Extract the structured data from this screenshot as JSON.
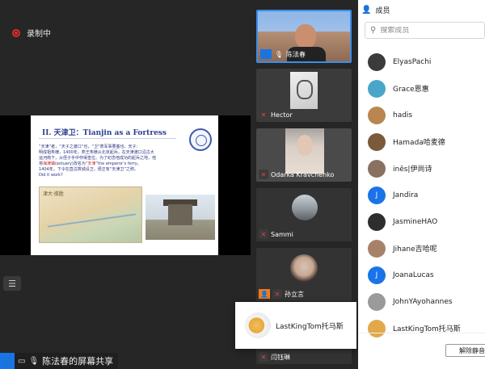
{
  "recording": {
    "label": "录制中"
  },
  "slide": {
    "title": "II. 天津卫：Tianjin as a Fortress",
    "body_line1": "“天津”者，“天子之渡口”也，“卫”表军事要塞也。天子：",
    "body_line2": "明成祖朱棣，1400年，燕王朱棣从北京起兵，在天津渡口沿古大",
    "body_line3": "运河南下，从侄子手中夺得皇位。为了纪念他成功的起兵之地，他",
    "body_line4a": "将",
    "body_line4_red1": "海津镇",
    "body_line4b": "(estuary)改名为“",
    "body_line4_red2": "天津",
    "body_line4c": "”the emperor’s ferry。",
    "body_line5": "1404年，下令在直沽筑城设卫，便正有“天津卫”之称。",
    "body_line6": "Did it work?",
    "map_caption": "津大·揽胜"
  },
  "share_bar": {
    "label": "陈法春的屏幕共享"
  },
  "tiles": [
    {
      "name": "陈法春"
    },
    {
      "name": "Hector"
    },
    {
      "name": "Odarka Kravchenko"
    },
    {
      "name": "Sammi"
    },
    {
      "name": "孙立言"
    },
    {
      "name": "闫钰琳"
    }
  ],
  "toast": {
    "name": "LastKingTom托马斯"
  },
  "panel": {
    "title": "成员",
    "search_placeholder": "搜索成员",
    "members": [
      {
        "name": "ElyasPachi",
        "color": "#3b3b3b"
      },
      {
        "name": "Grace恩惠",
        "color": "#4aa6c8"
      },
      {
        "name": "hadis",
        "color": "#b8864e"
      },
      {
        "name": "Hamada哈麦德",
        "color": "#7a5a3a"
      },
      {
        "name": "inês|伊尚诗",
        "color": "#8a7060"
      },
      {
        "name": "Jandira",
        "color": "#1a73e8",
        "initial": "J"
      },
      {
        "name": "JasmineHAO",
        "color": "#2e2e2e"
      },
      {
        "name": "Jihane吉哈呢",
        "color": "#a7826b"
      },
      {
        "name": "JoanaLucas",
        "color": "#1a73e8",
        "initial": "J"
      },
      {
        "name": "JohnYAyohannes",
        "color": "#9a9a9a"
      },
      {
        "name": "LastKingTom托马斯",
        "color": "#e2a84c"
      }
    ],
    "button_label": "解除静音"
  },
  "colors": {
    "accent": "#1a73e8",
    "recording": "#e02b2b",
    "orange": "#f07a1a"
  }
}
